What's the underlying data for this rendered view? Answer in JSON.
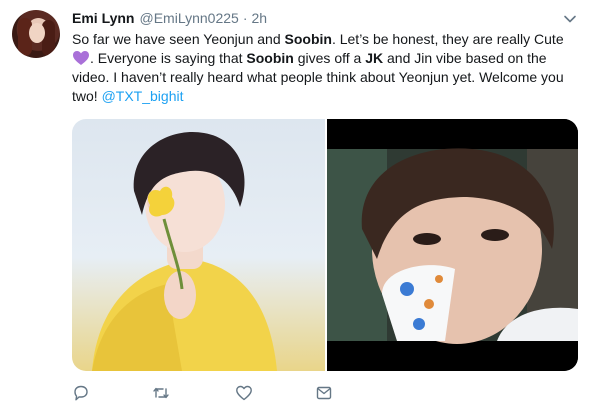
{
  "tweet": {
    "author_name": "Emi Lynn",
    "author_handle": "@EmiLynn0225",
    "separator": "·",
    "timestamp": "2h",
    "avatar_icon": "profile-photo",
    "text": {
      "part1": "So far we have seen Yeonjun and ",
      "bold1": "Soobin",
      "part2": ". Let’s be honest, they are really Cute ",
      "emoji": "purple-heart",
      "part3": ". Everyone is saying that ",
      "bold2": "Soobin",
      "part4": " gives off a ",
      "bold3": "JK",
      "part5": " and Jin vibe based on the video. I haven’t really heard what people think about Yeonjun yet. Welcome you two! ",
      "mention": "@TXT_bighit"
    },
    "media": [
      {
        "icon": "photo-boy-yellow-sweater-flower"
      },
      {
        "icon": "photo-boy-drinking-cup"
      }
    ],
    "actions": [
      {
        "icon": "reply-icon"
      },
      {
        "icon": "retweet-icon"
      },
      {
        "icon": "like-icon"
      },
      {
        "icon": "message-icon"
      }
    ],
    "menu_icon": "chevron-down-icon"
  },
  "colors": {
    "link": "#1da1f2",
    "secondary_text": "#657786",
    "heart": "#a970d8"
  }
}
